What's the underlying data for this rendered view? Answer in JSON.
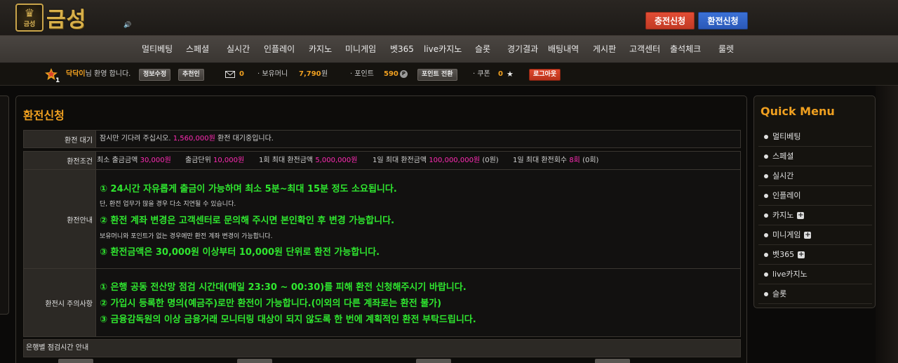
{
  "colors": {
    "accent": "#f0a020",
    "highlight": "#ff2bb4",
    "green_text": "#2fe62f",
    "deposit_button": "#d9432c",
    "withdraw_button": "#3266c8"
  },
  "header": {
    "logo_text": "금성",
    "logo_emblem_text": "금성",
    "deposit_button": "충전신청",
    "withdraw_button": "환전신청"
  },
  "menu": [
    "멀티베팅",
    "스페셜",
    "실시간",
    "인플레이",
    "카지노",
    "미니게임",
    "벳365",
    "live카지노",
    "슬롯",
    "경기결과",
    "배팅내역",
    "게시판",
    "고객센터",
    "출석체크",
    "룰렛"
  ],
  "userbar": {
    "username": "닥닥이",
    "welcome_suffix": "님 환영 합니다.",
    "edit_info_button": "정보수정",
    "referrer_button": "추천인",
    "messages_count": "0",
    "money_label": "· 보유머니",
    "money_value": "7,790",
    "money_unit": "원",
    "point_label": "· 포인트",
    "point_value": "590",
    "point_icon": "P",
    "point_convert_button": "포인트 전환",
    "coupon_label": "· 쿠폰",
    "coupon_value": "0",
    "logout_button": "로그아웃"
  },
  "main": {
    "title": "환전신청",
    "waiting": {
      "label": "환전 대기",
      "prefix": "잠시만 기다려 주십시오.",
      "amount": "1,560,000원",
      "suffix": "환전 대기중입니다."
    },
    "conditions": {
      "label": "환전조건",
      "items": [
        {
          "name": "최소 출금금액",
          "value": "30,000원",
          "extra": ""
        },
        {
          "name": "출금단위",
          "value": "10,000원",
          "extra": ""
        },
        {
          "name": "1회 최대 환전금액",
          "value": "5,000,000원",
          "extra": ""
        },
        {
          "name": "1일 최대 환전금액",
          "value": "100,000,000원",
          "extra": "(0원)"
        },
        {
          "name": "1일 최대 환전회수",
          "value": "8회",
          "extra": "(0회)"
        }
      ]
    },
    "guide": {
      "label": "환전안내",
      "line1": "① 24시간 자유롭게 출금이 가능하며 최소 5분~최대 15분 정도 소요됩니다.",
      "note1": "단, 환전 업무가 많을 경우 다소 지연될 수 있습니다.",
      "line2": "② 환전 계좌 변경은 고객센터로 문의해 주시면 본인확인 후 변경 가능합니다.",
      "note2": "보유머니와 포인트가 없는 경우에만 환전 계좌 변경이 가능합니다.",
      "line3": "③ 환전금액은 30,000원 이상부터 10,000원 단위로 환전 가능합니다."
    },
    "caution": {
      "label": "환전시 주의사항",
      "line1": "① 은행 공동 전산망 점검 시간대(매일 23:30 ~ 00:30)를 피해 환전 신청해주시기 바랍니다.",
      "line2": "② 가입시 등록한 명의(예금주)로만 환전이 가능합니다.(이외의 다른 계좌로는 환전 불가)",
      "line3": "③ 금융감독원의 이상 금융거래 모니터링 대상이 되지 않도록 한 번에 계획적인 환전 부탁드립니다."
    },
    "bank_maintenance_title": "은행별 점검시간 안내"
  },
  "quick_menu": {
    "title": "Quick Menu",
    "items": [
      {
        "label": "멀티베팅",
        "expandable": false
      },
      {
        "label": "스페셜",
        "expandable": false
      },
      {
        "label": "실시간",
        "expandable": false
      },
      {
        "label": "인플레이",
        "expandable": false
      },
      {
        "label": "카지노",
        "expandable": true
      },
      {
        "label": "미니게임",
        "expandable": true
      },
      {
        "label": "벳365",
        "expandable": true
      },
      {
        "label": "live카지노",
        "expandable": false
      },
      {
        "label": "슬롯",
        "expandable": false
      }
    ]
  }
}
